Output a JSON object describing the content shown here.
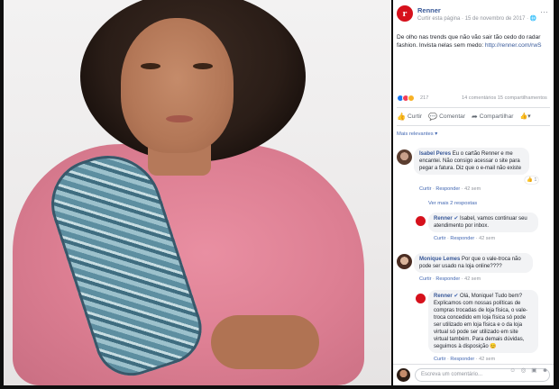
{
  "post": {
    "page_name": "Renner",
    "page_logo_letter": "r",
    "meta": "Curtir esta página · 15 de novembro de 2017 · ",
    "text_before_link": "De olho nas trends que não vão sair tão cedo do radar fashion. Invista nelas sem medo: ",
    "link_text": "http://renner.com/rwS",
    "reaction_count": "217",
    "comments_shares": "14 comentários 15 compartilhamentos",
    "colors": {
      "brand": "#d6111c",
      "link": "#385898"
    }
  },
  "actions": {
    "like": "Curtir",
    "comment": "Comentar",
    "share": "Compartilhar"
  },
  "relevant_label": "Mais relevantes ▾",
  "comments": [
    {
      "author": "Isabel Peres",
      "text": "Eu o cartão Renner e me encantei. Não consigo acessar o site para pegar a fatura. Diz que o e-mail não existe",
      "meta_like": "Curtir",
      "meta_reply": "Responder",
      "meta_time": "42 sem",
      "likes": "1"
    },
    {
      "author": "Renner",
      "text": "Isabel, vamos continuar seu atendimento por inbox.",
      "meta_like": "Curtir",
      "meta_reply": "Responder",
      "meta_time": "42 sem"
    },
    {
      "author": "Monique Lemes",
      "text": "Por que o vale-troca não pode ser usado na loja online????",
      "meta_like": "Curtir",
      "meta_reply": "Responder",
      "meta_time": "42 sem"
    },
    {
      "author": "Renner",
      "text": "Olá, Monique! Tudo bem? Explicamos com nossas políticas de compras trocadas de loja física, o vale-troca concedido em loja física só pode ser utilizado em loja física e o da loja virtual só pode ser utilizado em site virtual também. Para demais dúvidas, seguimos à disposição 😊",
      "meta_like": "Curtir",
      "meta_reply": "Responder",
      "meta_time": "42 sem"
    }
  ],
  "see_replies": "Ver mais 2 respostas",
  "compose_placeholder": "Escreva um comentário...",
  "compose_icons": "☺ ◎ ▣ ☻"
}
